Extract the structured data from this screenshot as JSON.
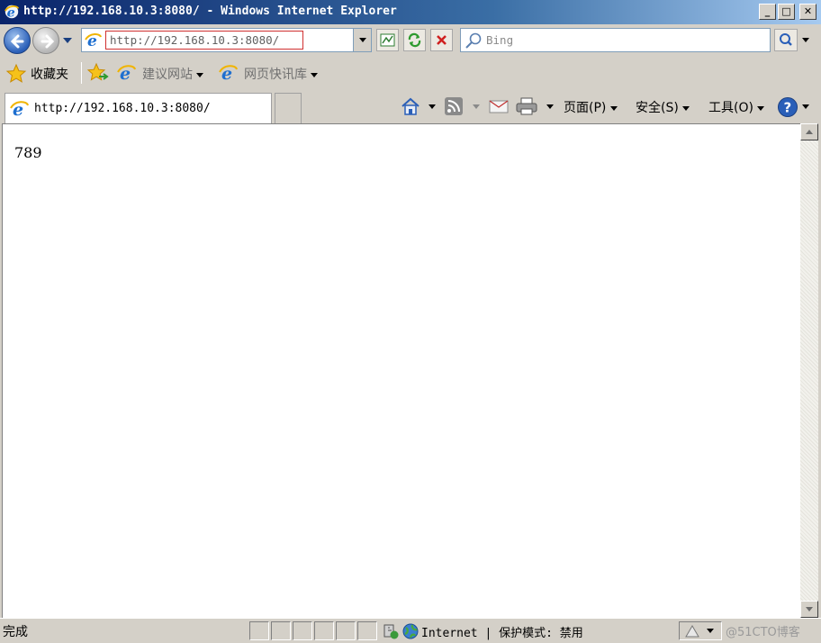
{
  "window": {
    "title": "http://192.168.10.3:8080/ - Windows Internet Explorer",
    "minimize": "_",
    "maximize": "□",
    "close": "✕"
  },
  "address_bar": {
    "url": "http://192.168.10.3:8080/"
  },
  "search": {
    "placeholder": "Bing"
  },
  "favorites_bar": {
    "favorites_label": "收藏夹",
    "links": [
      {
        "label": "建议网站"
      },
      {
        "label": "网页快讯库"
      }
    ]
  },
  "tabs": [
    {
      "label": "http://192.168.10.3:8080/"
    }
  ],
  "command_bar": {
    "page": "页面(P)",
    "safety": "安全(S)",
    "tools": "工具(O)"
  },
  "page": {
    "body_text": "789"
  },
  "status_bar": {
    "status": "完成",
    "zone": "Internet | 保护模式: 禁用",
    "watermark": "@51CTO博客"
  },
  "icons": {
    "browser": "ie-icon",
    "back": "back-arrow-icon",
    "forward": "forward-arrow-icon",
    "home": "home-icon",
    "feeds": "rss-icon",
    "mail": "mail-icon",
    "print": "printer-icon",
    "help": "help-icon",
    "favorites": "star-icon"
  },
  "colors": {
    "titlebar_start": "#0a246a",
    "titlebar_end": "#a6caf0",
    "chrome": "#d4d0c8",
    "url_highlight_border": "#d03030"
  }
}
